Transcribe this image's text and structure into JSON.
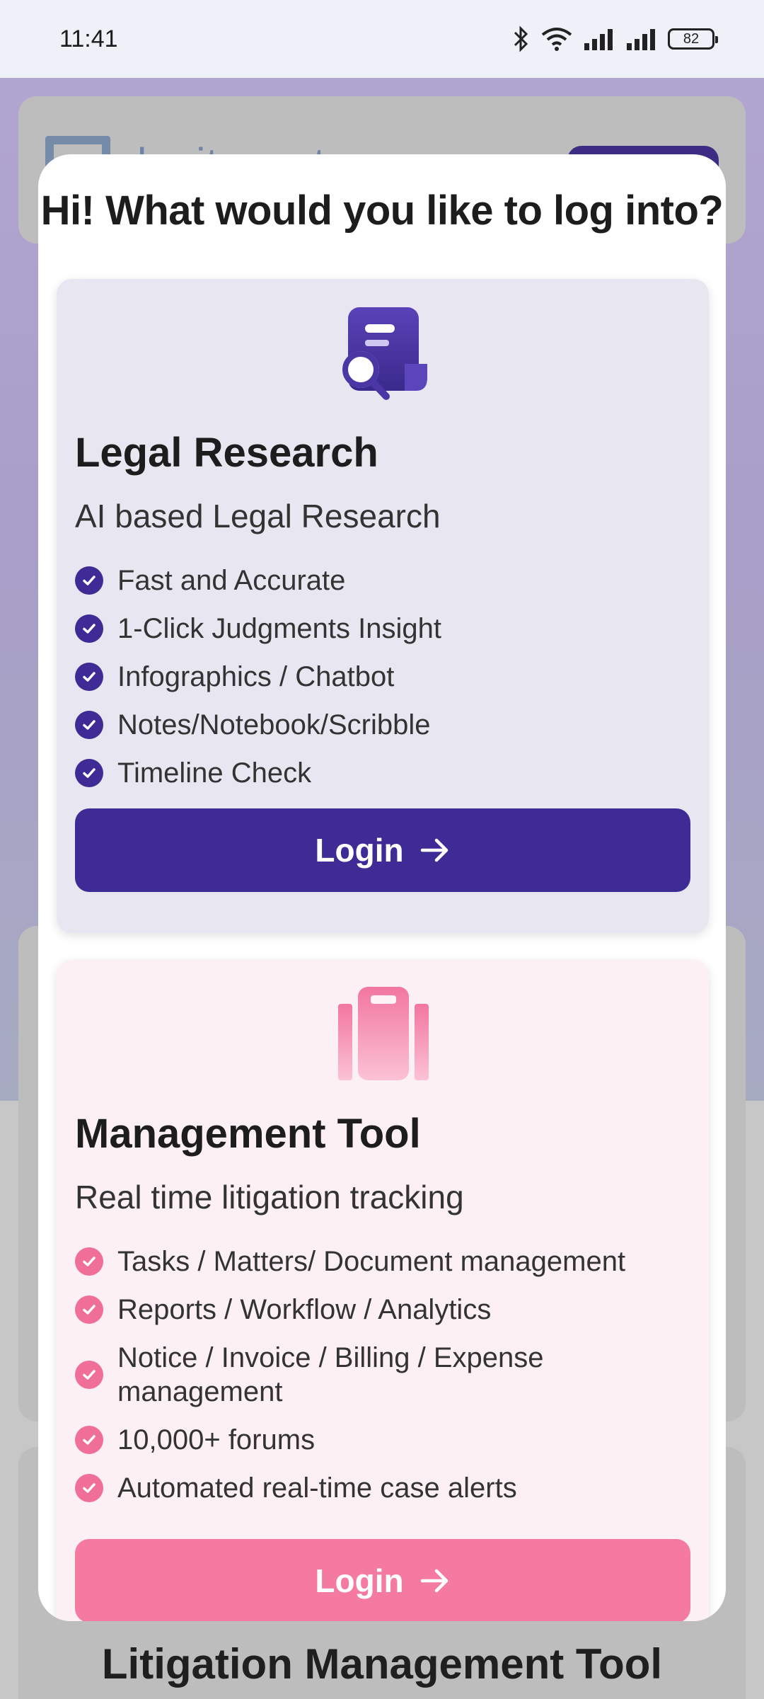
{
  "status_bar": {
    "time": "11:41",
    "battery": "82",
    "icons": [
      "bluetooth-icon",
      "wifi-icon",
      "signal-icon",
      "signal-icon",
      "battery-icon"
    ]
  },
  "background": {
    "logo_text": "legitquest",
    "bottom_title": "Litigation Management Tool"
  },
  "modal": {
    "title": "Hi! What would you like to log into?",
    "cards": [
      {
        "icon": "document-search-icon",
        "title": "Legal Research",
        "subtitle": "AI based Legal Research",
        "features": [
          "Fast and Accurate",
          "1-Click Judgments Insight",
          "Infographics / Chatbot",
          "Notes/Notebook/Scribble",
          "Timeline Check"
        ],
        "button_label": "Login",
        "accent": "#3f2b96"
      },
      {
        "icon": "briefcase-icon",
        "title": "Management Tool",
        "subtitle": "Real time litigation tracking",
        "features": [
          "Tasks / Matters/ Document management",
          "Reports / Workflow / Analytics",
          "Notice / Invoice / Billing / Expense management",
          "10,000+ forums",
          "Automated real-time case alerts"
        ],
        "button_label": "Login",
        "accent": "#f57a9f"
      }
    ]
  }
}
